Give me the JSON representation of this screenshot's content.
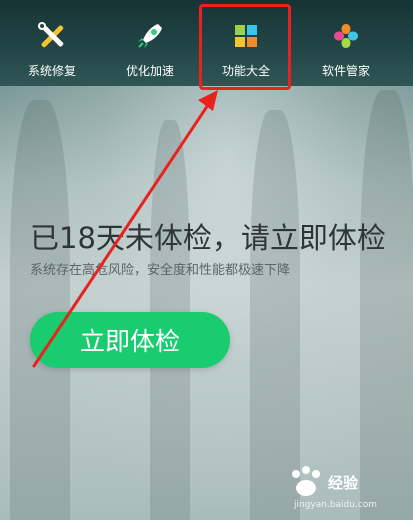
{
  "nav": {
    "items": [
      {
        "label": "系统修复",
        "icon": "wrench-screwdriver-icon"
      },
      {
        "label": "优化加速",
        "icon": "rocket-icon"
      },
      {
        "label": "功能大全",
        "icon": "app-grid-icon"
      },
      {
        "label": "软件管家",
        "icon": "flower-petals-icon"
      }
    ]
  },
  "main": {
    "headline": "已18天未体检，请立即体检",
    "subline": "系统存在高危风险，安全度和性能都极速下降",
    "check_button": "立即体检"
  },
  "watermark": {
    "brand": "经验",
    "url": "jingyan.baidu.com"
  },
  "colors": {
    "accent": "#19cc6f",
    "annotation": "#e8231d",
    "navbar": "#1d3c3c"
  }
}
